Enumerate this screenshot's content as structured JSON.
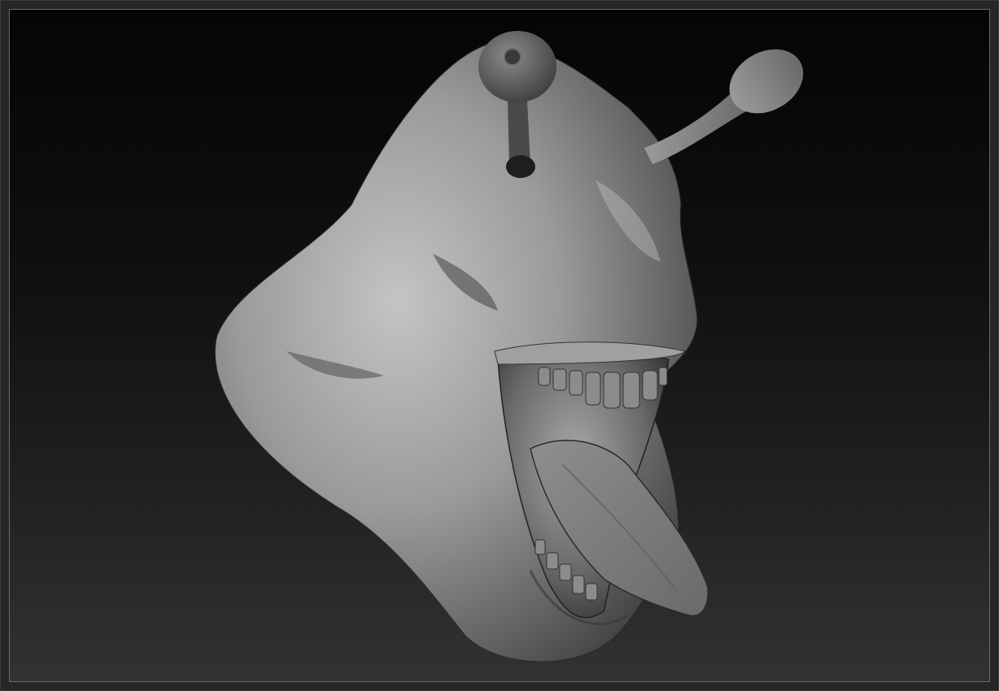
{
  "viewport": {
    "content": "sculpt-render",
    "background_top": "#050505",
    "background_bottom": "#323232",
    "border_color": "#6a6a6a"
  },
  "colors": {
    "clay_light": "#b8b8b8",
    "clay_mid": "#8a8a8a",
    "clay_dark": "#3c3c3c",
    "eyeball": "#5a5a5a"
  }
}
